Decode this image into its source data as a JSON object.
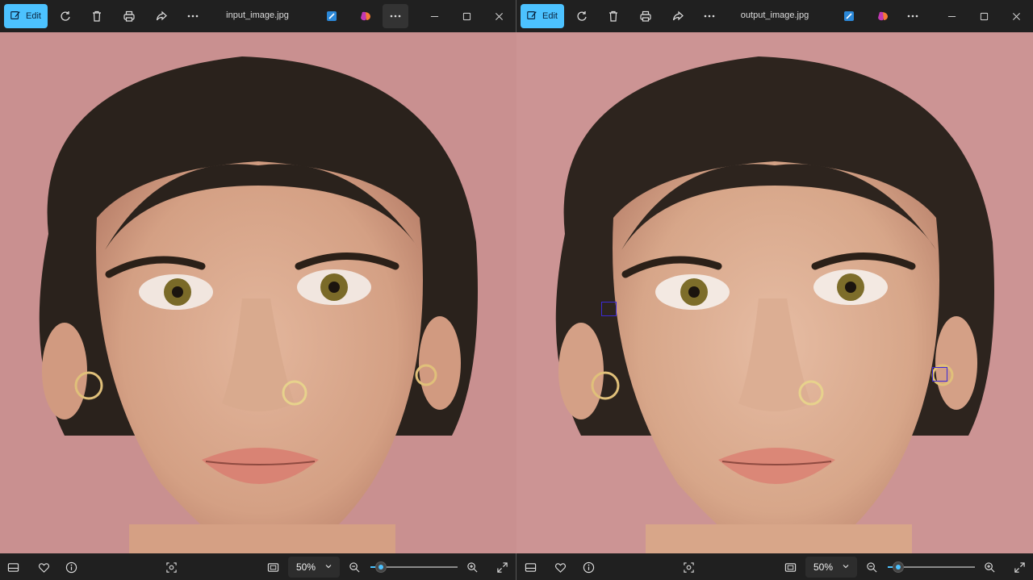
{
  "colors": {
    "accent": "#4cc2ff",
    "toolbar_bg": "#202020",
    "photo_background": "#c99090",
    "marker": "#3b2ad6"
  },
  "panes": [
    {
      "edit_label": "Edit",
      "filename": "input_image.jpg",
      "zoom": "50%",
      "zoom_level": 0.12,
      "markers": []
    },
    {
      "edit_label": "Edit",
      "filename": "output_image.jpg",
      "zoom": "50%",
      "zoom_level": 0.12,
      "markers": [
        "marker-left-ear",
        "marker-right-jaw"
      ]
    }
  ],
  "icons": {
    "toolbar": [
      "edit-icon",
      "rotate-icon",
      "delete-icon",
      "print-icon",
      "share-icon",
      "more-icon",
      "paint-icon",
      "copilot-icon",
      "more-options-icon"
    ],
    "window": [
      "minimize-icon",
      "maximize-icon",
      "close-icon"
    ],
    "bottom": [
      "filmstrip-icon",
      "favorite-icon",
      "info-icon",
      "visual-search-icon",
      "fit-icon",
      "zoom-out-icon",
      "zoom-in-icon",
      "fullscreen-icon"
    ]
  }
}
